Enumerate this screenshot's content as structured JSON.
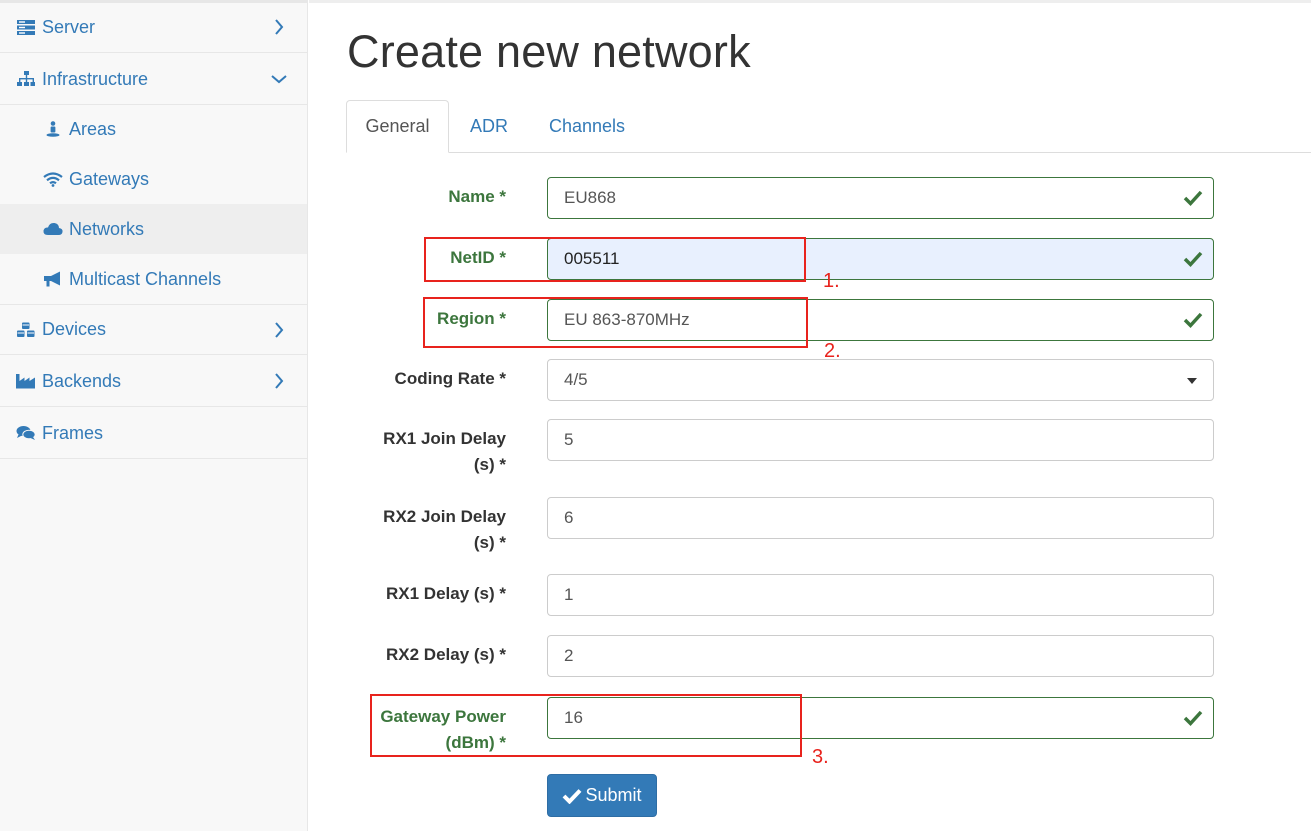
{
  "sidebar": {
    "items": [
      {
        "label": "Server"
      },
      {
        "label": "Infrastructure"
      },
      {
        "label": "Areas"
      },
      {
        "label": "Gateways"
      },
      {
        "label": "Networks"
      },
      {
        "label": "Multicast Channels"
      },
      {
        "label": "Devices"
      },
      {
        "label": "Backends"
      },
      {
        "label": "Frames"
      }
    ]
  },
  "page": {
    "title": "Create new network"
  },
  "tabs": [
    {
      "label": "General",
      "active": true
    },
    {
      "label": "ADR",
      "active": false
    },
    {
      "label": "Channels",
      "active": false
    }
  ],
  "form": {
    "name": {
      "label": "Name *",
      "value": "EU868"
    },
    "netid": {
      "label": "NetID *",
      "value": "005511"
    },
    "region": {
      "label": "Region *",
      "value": "EU 863-870MHz"
    },
    "coding_rate": {
      "label": "Coding Rate *",
      "value": "4/5"
    },
    "rx1_join_delay": {
      "label_line1": "RX1 Join Delay",
      "label_line2": "(s) *",
      "value": "5"
    },
    "rx2_join_delay": {
      "label_line1": "RX2 Join Delay",
      "label_line2": "(s) *",
      "value": "6"
    },
    "rx1_delay": {
      "label": "RX1 Delay (s) *",
      "value": "1"
    },
    "rx2_delay": {
      "label": "RX2 Delay (s) *",
      "value": "2"
    },
    "gateway_power": {
      "label_line1": "Gateway Power",
      "label_line2": "(dBm) *",
      "value": "16"
    },
    "submit_label": "Submit"
  },
  "annotations": [
    "1.",
    "2.",
    "3."
  ],
  "colors": {
    "link": "#337ab7",
    "success": "#3c763d",
    "annotation": "#e8231d",
    "autofill": "#e8f0fe"
  }
}
